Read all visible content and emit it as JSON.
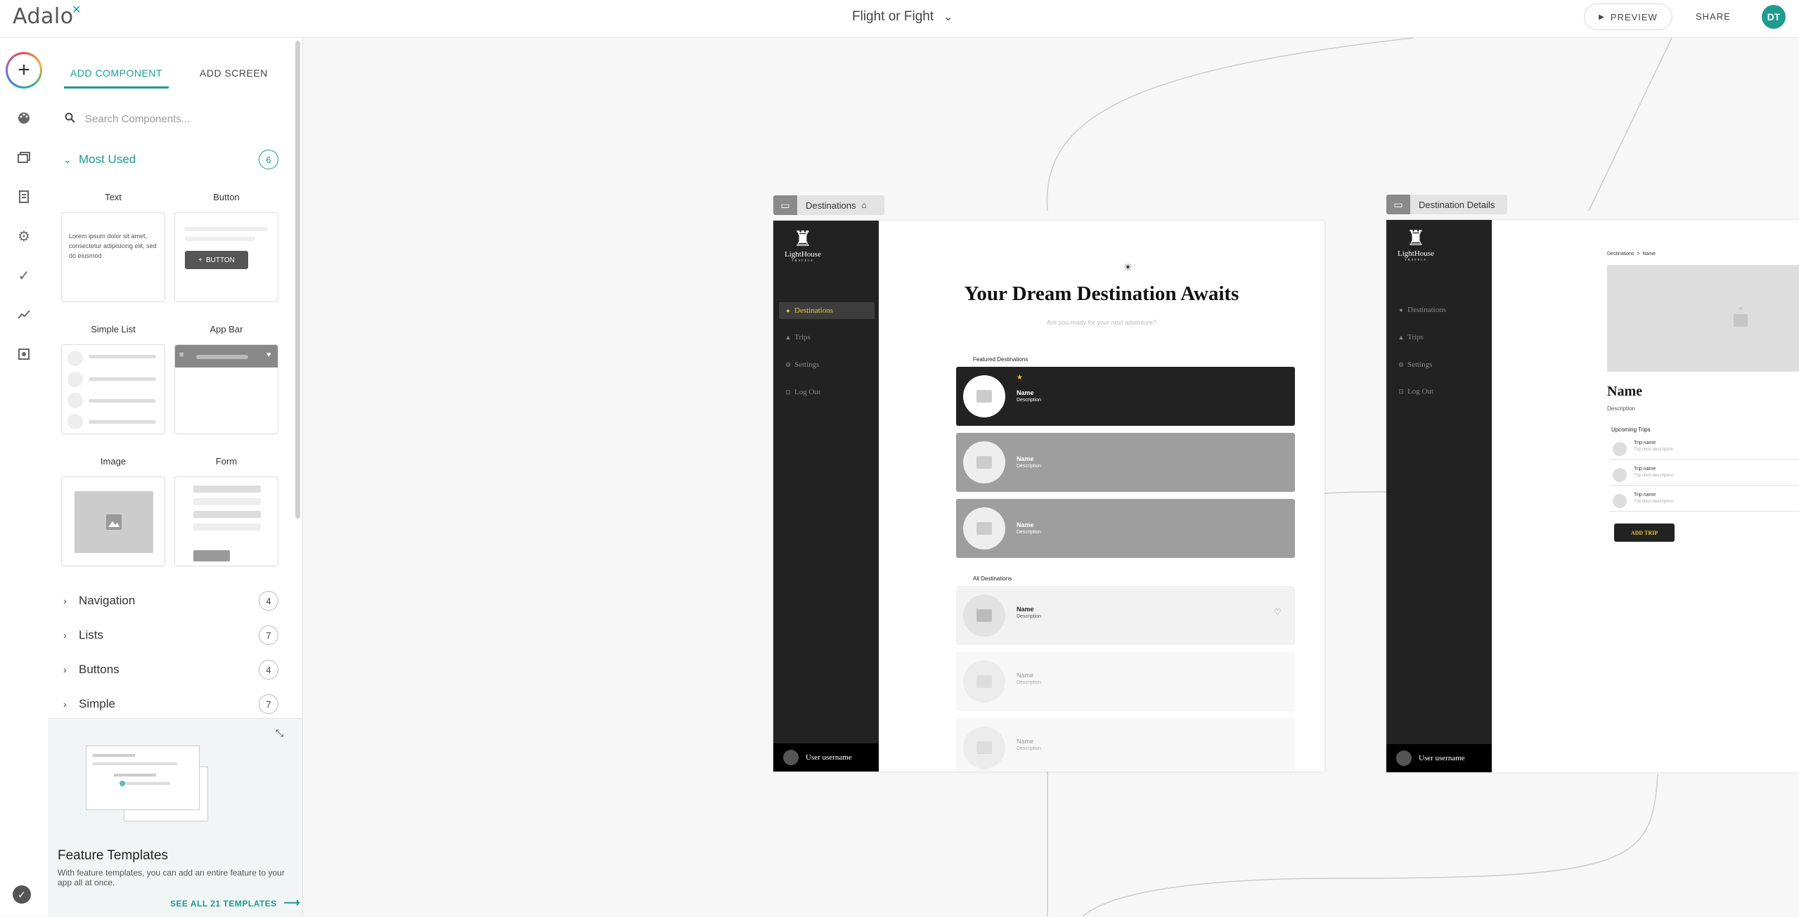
{
  "app": {
    "logo": "Adalo",
    "title": "Flight or Fight",
    "preview_label": "PREVIEW",
    "share_label": "SHARE",
    "avatar_initials": "DT",
    "accent": "#1a9a95"
  },
  "panel": {
    "tabs": [
      "ADD COMPONENT",
      "ADD SCREEN"
    ],
    "search_placeholder": "Search Components...",
    "most_used": {
      "label": "Most Used",
      "count": "6"
    },
    "components": [
      {
        "label": "Text",
        "preview_text": "Lorem ipsum dolor sit amet, consectetur adipisicing elit, sed do eiusmod"
      },
      {
        "label": "Button",
        "button_text": "BUTTON"
      },
      {
        "label": "Simple List"
      },
      {
        "label": "App Bar"
      },
      {
        "label": "Image"
      },
      {
        "label": "Form"
      }
    ],
    "categories": [
      {
        "label": "Navigation",
        "count": "4"
      },
      {
        "label": "Lists",
        "count": "7"
      },
      {
        "label": "Buttons",
        "count": "4"
      },
      {
        "label": "Simple",
        "count": "7"
      }
    ],
    "feature_templates": {
      "title": "Feature Templates",
      "description": "With feature templates, you can add an entire feature to your app all at once.",
      "link": "SEE ALL 21 TEMPLATES"
    }
  },
  "screens": {
    "destinations": {
      "tag": "Destinations",
      "brand_name": "LightHouse",
      "brand_sub": "TRAVELS",
      "nav": [
        "Destinations",
        "Trips",
        "Settings",
        "Log Out"
      ],
      "user": "User username",
      "heading": "Your Dream Destination Awaits",
      "subheading": "Are you ready for your next adventure?",
      "featured_label": "Featured Destinations",
      "all_label": "All Destinations",
      "item_name": "Name",
      "item_desc": "Description"
    },
    "details": {
      "tag": "Destination Details",
      "breadcrumb": "Destinations  >  Name",
      "name": "Name",
      "description": "Description",
      "upcoming_label": "Upcoming Trips",
      "trip_name": "Trip name",
      "trip_desc": "Trip short description",
      "add_trip": "ADD TRIP"
    }
  }
}
